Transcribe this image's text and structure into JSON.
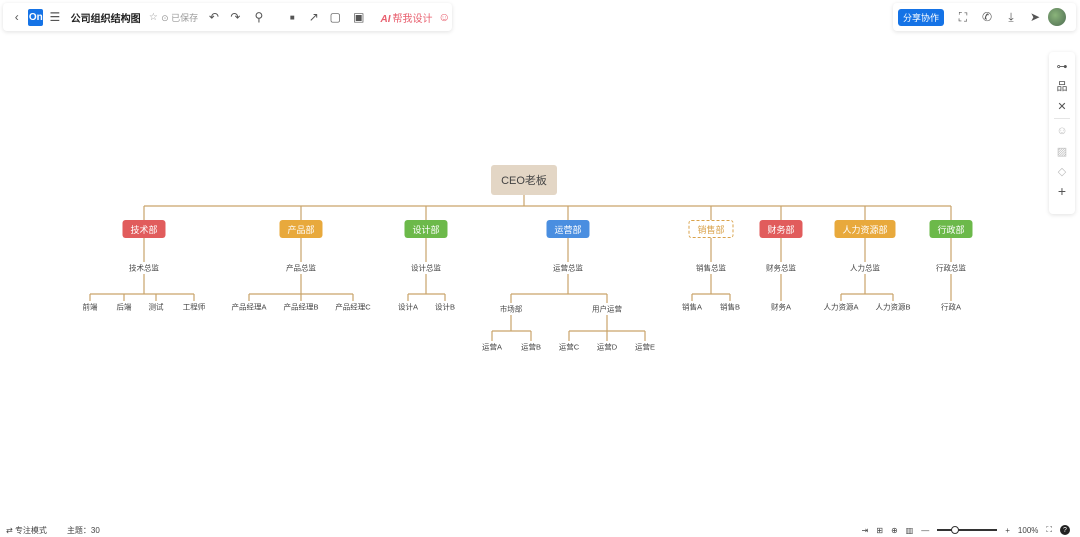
{
  "toolbar": {
    "logo_text": "On",
    "doc_title": "公司组织结构图",
    "saved_status": "已保存",
    "ai_label": "AI",
    "ai_text": "帮我设计",
    "share_label": "分享协作",
    "icons_left": [
      "back-icon",
      "menu-icon",
      "star-icon",
      "undo-icon",
      "redo-icon",
      "format-paint-icon",
      "fill-icon",
      "line-icon",
      "frame-icon",
      "image-icon"
    ],
    "icons_right": [
      "present-icon",
      "phone-icon",
      "download-icon",
      "send-icon"
    ]
  },
  "side_panel": {
    "icons": [
      "connector-icon",
      "structure-icon",
      "layout-icon",
      "emoji-icon",
      "image-icon",
      "tag-icon",
      "add-icon"
    ]
  },
  "orgchart": {
    "root": "CEO老板",
    "departments": [
      {
        "name": "技术部",
        "color": "#e15c5c",
        "head": "技术总监",
        "members": [
          "前端",
          "后端",
          "测试",
          "工程师"
        ]
      },
      {
        "name": "产品部",
        "color": "#e8a93c",
        "head": "产品总监",
        "members": [
          "产品经理A",
          "产品经理B",
          "产品经理C"
        ]
      },
      {
        "name": "设计部",
        "color": "#6cb94a",
        "head": "设计总监",
        "members": [
          "设计A",
          "设计B"
        ]
      },
      {
        "name": "运营部",
        "color": "#4a8ee0",
        "head": "运营总监",
        "subgroups": [
          {
            "name": "市场部",
            "members": [
              "运营A",
              "运营B"
            ]
          },
          {
            "name": "用户运营",
            "members": [
              "运营C",
              "运营D",
              "运营E"
            ]
          }
        ]
      },
      {
        "name": "销售部",
        "color": "#d9a24a",
        "dashed": true,
        "head": "销售总监",
        "members": [
          "销售A",
          "销售B"
        ]
      },
      {
        "name": "财务部",
        "color": "#e15c5c",
        "head": "财务总监",
        "members": [
          "财务A"
        ]
      },
      {
        "name": "人力资源部",
        "color": "#e8a93c",
        "head": "人力总监",
        "members": [
          "人力资源A",
          "人力资源B"
        ]
      },
      {
        "name": "行政部",
        "color": "#6cb94a",
        "head": "行政总监",
        "members": [
          "行政A"
        ]
      }
    ]
  },
  "statusbar": {
    "mode_label": "专注模式",
    "count_label": "主题：30",
    "zoom": "100%",
    "help": "?"
  },
  "colors": {
    "line": "#c9a46a",
    "accent": "#1573e6"
  }
}
